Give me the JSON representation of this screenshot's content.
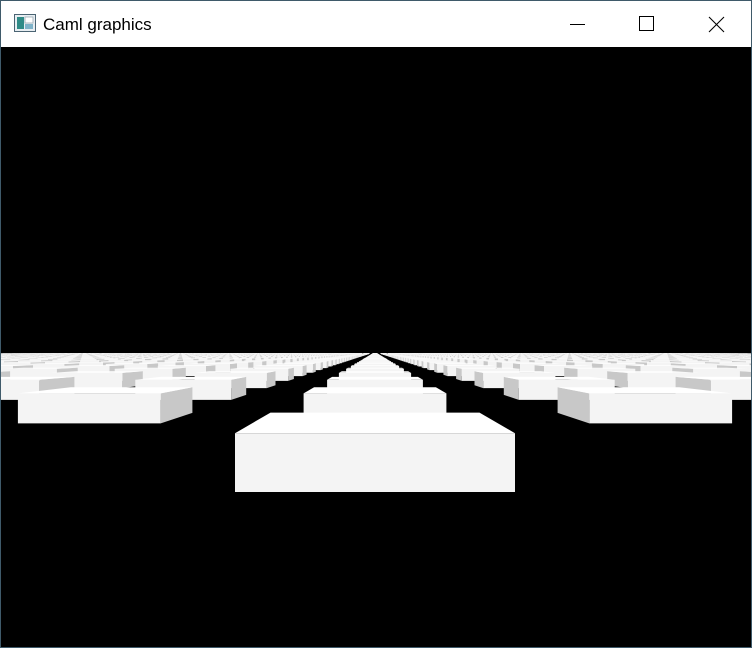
{
  "window": {
    "title": "Caml graphics",
    "controls": {
      "minimize": "minimize-icon",
      "maximize": "maximize-icon",
      "close": "close-icon"
    }
  },
  "scene": {
    "background": "#000000",
    "block_color": "#f4f4f4",
    "block_side_color": "#c8c8c8"
  }
}
